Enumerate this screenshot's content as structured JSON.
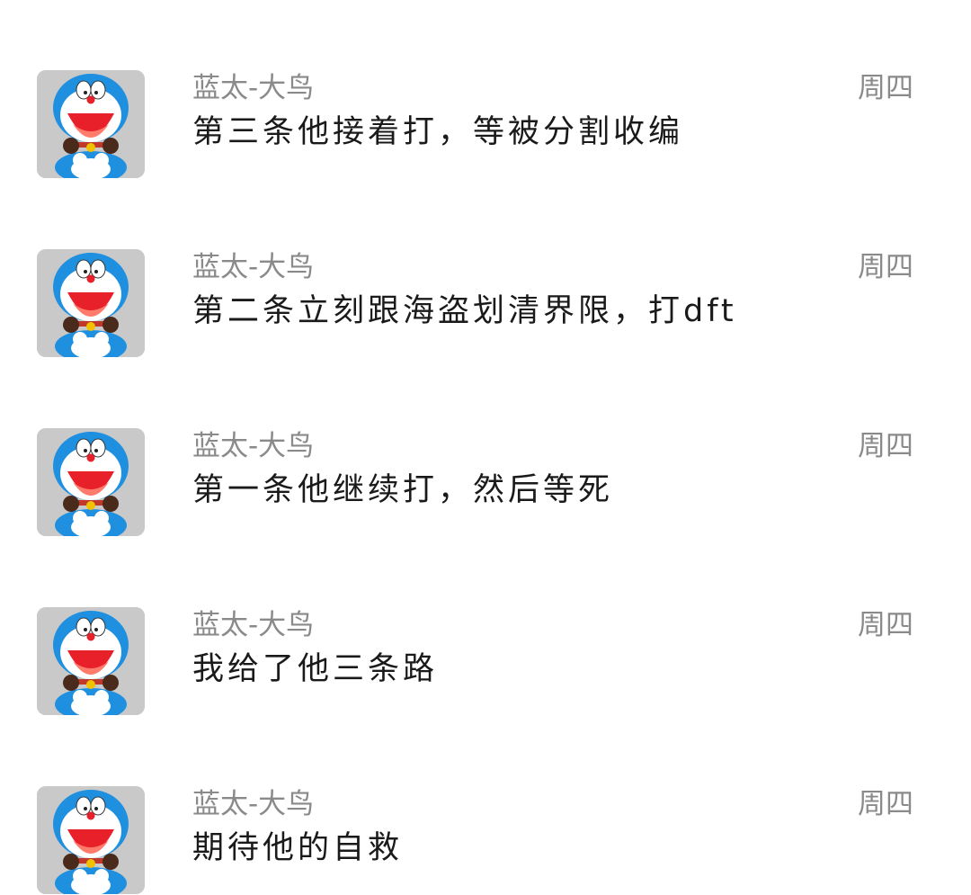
{
  "conversation_list": {
    "items": [
      {
        "sender": "蓝太-大鸟",
        "message": "第三条他接着打，等被分割收编",
        "time": "周四",
        "avatar_icon": "doraemon-avatar-icon"
      },
      {
        "sender": "蓝太-大鸟",
        "message": "第二条立刻跟海盗划清界限，打dft",
        "time": "周四",
        "avatar_icon": "doraemon-avatar-icon"
      },
      {
        "sender": "蓝太-大鸟",
        "message": "第一条他继续打，然后等死",
        "time": "周四",
        "avatar_icon": "doraemon-avatar-icon"
      },
      {
        "sender": "蓝太-大鸟",
        "message": "我给了他三条路",
        "time": "周四",
        "avatar_icon": "doraemon-avatar-icon"
      },
      {
        "sender": "蓝太-大鸟",
        "message": "期待他的自救",
        "time": "周四",
        "avatar_icon": "doraemon-avatar-icon"
      }
    ]
  },
  "colors": {
    "background": "#ffffff",
    "sender_text": "#8a8a8a",
    "message_text": "#1a1a1a",
    "avatar_background": "#c9c9c9",
    "doraemon_blue": "#1f8fe0",
    "doraemon_red": "#e8202a"
  }
}
